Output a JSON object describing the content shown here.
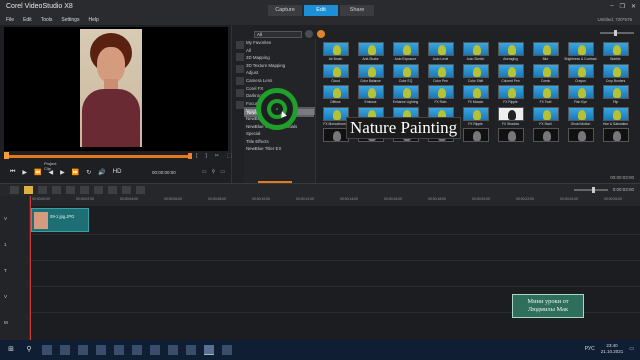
{
  "window": {
    "app_title": "Corel VideoStudio X8",
    "tabs": [
      "Capture",
      "Edit",
      "Share"
    ],
    "active_tab": "Edit",
    "project_name": "Untitled, 720*576",
    "controls": [
      "–",
      "❐",
      "✕"
    ]
  },
  "menu": [
    "File",
    "Edit",
    "Tools",
    "Settings",
    "Help"
  ],
  "player": {
    "modes": [
      "Project",
      "Clip"
    ],
    "buttons": [
      "⏮",
      "▶",
      "⏪",
      "◀",
      "▶",
      "⏩",
      "↻",
      "🔊",
      "HD"
    ],
    "brackets": [
      "[",
      "]",
      "✂",
      "⬚"
    ],
    "extra_icons": [
      "▭",
      "⚲",
      "▭"
    ],
    "timecode": "00:00:00:00"
  },
  "library": {
    "dropdown_value": "All",
    "categories": [
      "My Favorites",
      "All",
      "2D Mapping",
      "3D Texture Mapping",
      "Adjust",
      "Camera Lens",
      "Corel FX",
      "Darkroom",
      "Focus",
      "NewBlue Painting",
      "NewBlue Title FX",
      "NewBlue Video Essentials",
      "Special",
      "Title Effects",
      "NewBlue Titler EX"
    ],
    "selected_category_index": 9,
    "filters": [
      "Air Brush",
      "Anti-Shake",
      "Auto Exposure",
      "Auto Level",
      "Auto Sketch",
      "Averaging",
      "Blur",
      "Brightness & Contrast",
      "Bubble",
      "Cloud",
      "Color Balance",
      "Color EQ",
      "Color Pen",
      "Color Shift",
      "Colored Pen",
      "Comic",
      "Crayon",
      "Crop Borders",
      "Diffuse",
      "Emboss",
      "Enhance Lighting",
      "FX Rain",
      "FX Mosaic",
      "FX Ripple",
      "FX Twirl",
      "Fish Eye",
      "Flip",
      "FX Monochrome",
      "FX Mosaic",
      "FX Pixels",
      "FX Punch",
      "FX Ripple",
      "FX Shadow",
      "FX Swirl",
      "Ghost Motion",
      "Hue & Saturation",
      "",
      "",
      "",
      "",
      "",
      "",
      "",
      "",
      ""
    ],
    "filter_styles": [
      "",
      "",
      "",
      "",
      "",
      "",
      "",
      "",
      "",
      "",
      "",
      "",
      "",
      "",
      "",
      "",
      "",
      "",
      "",
      "",
      "",
      "",
      "",
      "",
      "",
      "",
      "",
      "",
      "",
      "",
      "",
      "",
      "white",
      "",
      "",
      "",
      "",
      "",
      "",
      "",
      "",
      "",
      "",
      "",
      ""
    ],
    "time_readout": "00:00:03:00"
  },
  "overlay": {
    "hover_category": "NewBlue Painting",
    "big_label": "Nature Painting"
  },
  "timeline": {
    "duration": "0:00:03:00",
    "ruler": [
      "00:00:00:00",
      "00:00:02:00",
      "00:00:04:00",
      "00:00:06:00",
      "00:00:08:00",
      "00:00:10:00",
      "00:00:12:00",
      "00:00:14:00",
      "00:00:16:00",
      "00:00:18:00",
      "00:00:20:00",
      "00:00:22:00",
      "00:00:24:00",
      "00:00:26:00"
    ],
    "tracks": [
      "V",
      "1",
      "T",
      "V",
      "M"
    ],
    "clip_label": "09-1 jpg.JPG"
  },
  "watermark": {
    "line1": "Мини уроки от",
    "line2": "Людмилы Мак"
  },
  "taskbar": {
    "time": "23:40",
    "date": "21.10.2021",
    "lang": "РУС"
  }
}
